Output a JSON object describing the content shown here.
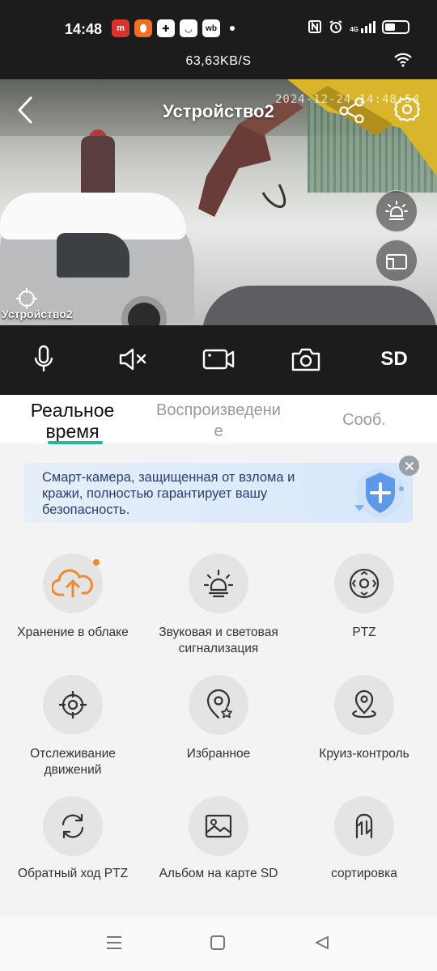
{
  "status_bar": {
    "time": "14:48",
    "network_speed": "63,63KB/S",
    "apps": [
      {
        "icon": "app-red-icon",
        "color": "#d9342b",
        "text": "m"
      },
      {
        "icon": "app-orange-icon",
        "color": "#f36f21",
        "text": ""
      },
      {
        "icon": "app-plus-icon",
        "color": "#1c1c1c",
        "text": "✚"
      },
      {
        "icon": "app-smile-icon",
        "color": "#1c1c1c",
        "text": "◡"
      },
      {
        "icon": "app-wb-icon",
        "color": "#1c1c1c",
        "text": "wb"
      }
    ],
    "network_type": "4G",
    "icons": [
      "nfc-icon",
      "alarm-icon",
      "signal-icon",
      "battery-icon",
      "wifi-icon"
    ]
  },
  "video": {
    "device_title": "Устройство2",
    "timestamp": "2024-12-24 14:48:54",
    "device_label": "Устройство2"
  },
  "controls": {
    "items": [
      "microphone-icon",
      "mute-icon",
      "record-icon",
      "snapshot-icon"
    ],
    "sd_label": "SD"
  },
  "tabs": [
    {
      "label_line1": "Реальное",
      "label_line2": "время",
      "active": true
    },
    {
      "label_line1": "Воспроизведени",
      "label_line2": "е",
      "active": false
    },
    {
      "label_line1": "Сооб.",
      "label_line2": "",
      "active": false
    }
  ],
  "banner": {
    "text": "Смарт-камера, защищенная от взлома и кражи, полностью гарантирует вашу безопасность."
  },
  "features": [
    {
      "label_line1": "Хранение в облаке",
      "label_line2": "",
      "icon": "cloud-upload-icon",
      "badge": true
    },
    {
      "label_line1": "Звуковая и световая",
      "label_line2": "сигнализация",
      "icon": "light-alarm-icon",
      "badge": false
    },
    {
      "label_line1": "PTZ",
      "label_line2": "",
      "icon": "ptz-icon",
      "badge": false
    },
    {
      "label_line1": "Отслеживание",
      "label_line2": "движений",
      "icon": "motion-tracking-icon",
      "badge": false
    },
    {
      "label_line1": "Избранное",
      "label_line2": "",
      "icon": "favorite-location-icon",
      "badge": false
    },
    {
      "label_line1": "Круиз-контроль",
      "label_line2": "",
      "icon": "cruise-control-icon",
      "badge": false
    },
    {
      "label_line1": "Обратный ход PTZ",
      "label_line2": "",
      "icon": "reverse-ptz-icon",
      "badge": false
    },
    {
      "label_line1": "Альбом на карте SD",
      "label_line2": "",
      "icon": "sd-album-icon",
      "badge": false
    },
    {
      "label_line1": "сортировка",
      "label_line2": "",
      "icon": "sort-icon",
      "badge": false
    }
  ],
  "colors": {
    "accent_teal": "#28b5a1",
    "badge_orange": "#f08a2c",
    "cloud_orange": "#f08a2c",
    "dark_bar": "#1c1c1c"
  }
}
